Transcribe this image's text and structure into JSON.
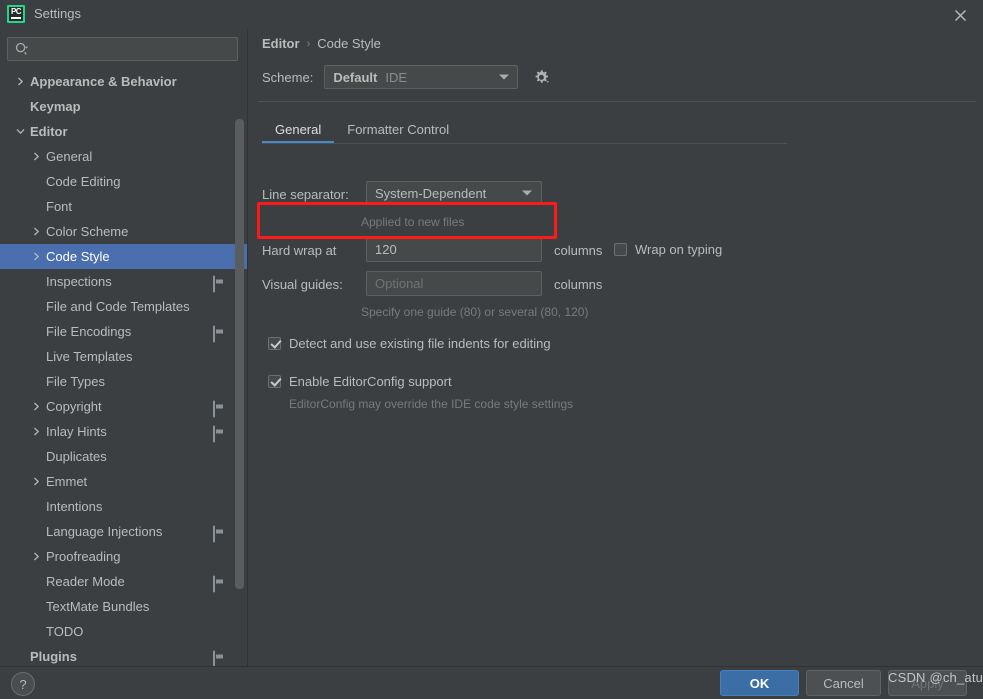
{
  "window": {
    "title": "Settings",
    "app_icon": "pycharm-pc-logo",
    "close_icon": "close-icon"
  },
  "sidebar": {
    "search": {
      "placeholder": "",
      "value": "",
      "icon": "search-with-dropdown-icon"
    },
    "items": [
      {
        "label": "Appearance & Behavior",
        "arrow": "chevron-right",
        "indent": 0,
        "bold": true,
        "badge": false,
        "selected": false
      },
      {
        "label": "Keymap",
        "arrow": "none",
        "indent": 0,
        "bold": true,
        "badge": false,
        "selected": false
      },
      {
        "label": "Editor",
        "arrow": "chevron-down",
        "indent": 0,
        "bold": true,
        "badge": false,
        "selected": false
      },
      {
        "label": "General",
        "arrow": "chevron-right",
        "indent": 1,
        "bold": false,
        "badge": false,
        "selected": false
      },
      {
        "label": "Code Editing",
        "arrow": "none",
        "indent": 1,
        "bold": false,
        "badge": false,
        "selected": false
      },
      {
        "label": "Font",
        "arrow": "none",
        "indent": 1,
        "bold": false,
        "badge": false,
        "selected": false
      },
      {
        "label": "Color Scheme",
        "arrow": "chevron-right",
        "indent": 1,
        "bold": false,
        "badge": false,
        "selected": false
      },
      {
        "label": "Code Style",
        "arrow": "chevron-right",
        "indent": 1,
        "bold": false,
        "badge": false,
        "selected": true
      },
      {
        "label": "Inspections",
        "arrow": "none",
        "indent": 1,
        "bold": false,
        "badge": true,
        "selected": false
      },
      {
        "label": "File and Code Templates",
        "arrow": "none",
        "indent": 1,
        "bold": false,
        "badge": false,
        "selected": false
      },
      {
        "label": "File Encodings",
        "arrow": "none",
        "indent": 1,
        "bold": false,
        "badge": true,
        "selected": false
      },
      {
        "label": "Live Templates",
        "arrow": "none",
        "indent": 1,
        "bold": false,
        "badge": false,
        "selected": false
      },
      {
        "label": "File Types",
        "arrow": "none",
        "indent": 1,
        "bold": false,
        "badge": false,
        "selected": false
      },
      {
        "label": "Copyright",
        "arrow": "chevron-right",
        "indent": 1,
        "bold": false,
        "badge": true,
        "selected": false
      },
      {
        "label": "Inlay Hints",
        "arrow": "chevron-right",
        "indent": 1,
        "bold": false,
        "badge": true,
        "selected": false
      },
      {
        "label": "Duplicates",
        "arrow": "none",
        "indent": 1,
        "bold": false,
        "badge": false,
        "selected": false
      },
      {
        "label": "Emmet",
        "arrow": "chevron-right",
        "indent": 1,
        "bold": false,
        "badge": false,
        "selected": false
      },
      {
        "label": "Intentions",
        "arrow": "none",
        "indent": 1,
        "bold": false,
        "badge": false,
        "selected": false
      },
      {
        "label": "Language Injections",
        "arrow": "none",
        "indent": 1,
        "bold": false,
        "badge": true,
        "selected": false
      },
      {
        "label": "Proofreading",
        "arrow": "chevron-right",
        "indent": 1,
        "bold": false,
        "badge": false,
        "selected": false
      },
      {
        "label": "Reader Mode",
        "arrow": "none",
        "indent": 1,
        "bold": false,
        "badge": true,
        "selected": false
      },
      {
        "label": "TextMate Bundles",
        "arrow": "none",
        "indent": 1,
        "bold": false,
        "badge": false,
        "selected": false
      },
      {
        "label": "TODO",
        "arrow": "none",
        "indent": 1,
        "bold": false,
        "badge": false,
        "selected": false
      },
      {
        "label": "Plugins",
        "arrow": "none",
        "indent": 0,
        "bold": true,
        "badge": true,
        "selected": false
      }
    ]
  },
  "main": {
    "breadcrumb": {
      "parent": "Editor",
      "separator": "›",
      "current": "Code Style"
    },
    "scheme": {
      "label": "Scheme:",
      "value": "Default",
      "scope": "IDE",
      "gear_icon": "gear-icon",
      "caret_icon": "chevron-down-icon"
    },
    "tabs": [
      {
        "label": "General",
        "active": true
      },
      {
        "label": "Formatter Control",
        "active": false
      }
    ],
    "form": {
      "line_separator_label": "Line separator:",
      "line_separator_value": "System-Dependent",
      "line_separator_hint": "Applied to new files",
      "hard_wrap_label": "Hard wrap at",
      "hard_wrap_value": "120",
      "hard_wrap_units": "columns",
      "wrap_on_typing_label": "Wrap on typing",
      "wrap_on_typing_checked": false,
      "visual_guides_label": "Visual guides:",
      "visual_guides_placeholder": "Optional",
      "visual_guides_value": "",
      "visual_guides_units": "columns",
      "visual_guides_hint": "Specify one guide (80) or several (80, 120)",
      "detect_indents_label": "Detect and use existing file indents for editing",
      "detect_indents_checked": true,
      "editorconfig_label": "Enable EditorConfig support",
      "editorconfig_checked": true,
      "editorconfig_hint": "EditorConfig may override the IDE code style settings"
    }
  },
  "footer": {
    "help_label": "?",
    "ok_label": "OK",
    "cancel_label": "Cancel",
    "apply_label": "Apply"
  },
  "watermark": "CSDN @ch_atu",
  "colors": {
    "background": "#3c3f41",
    "selection_blue": "#4b6eaf",
    "accent_blue": "#4a88c7",
    "primary_button": "#3b6ea5",
    "annotation_red": "#ff1a1a",
    "field_background": "#45494a",
    "text": "#bbbbbb",
    "muted_text": "#787b7d"
  }
}
